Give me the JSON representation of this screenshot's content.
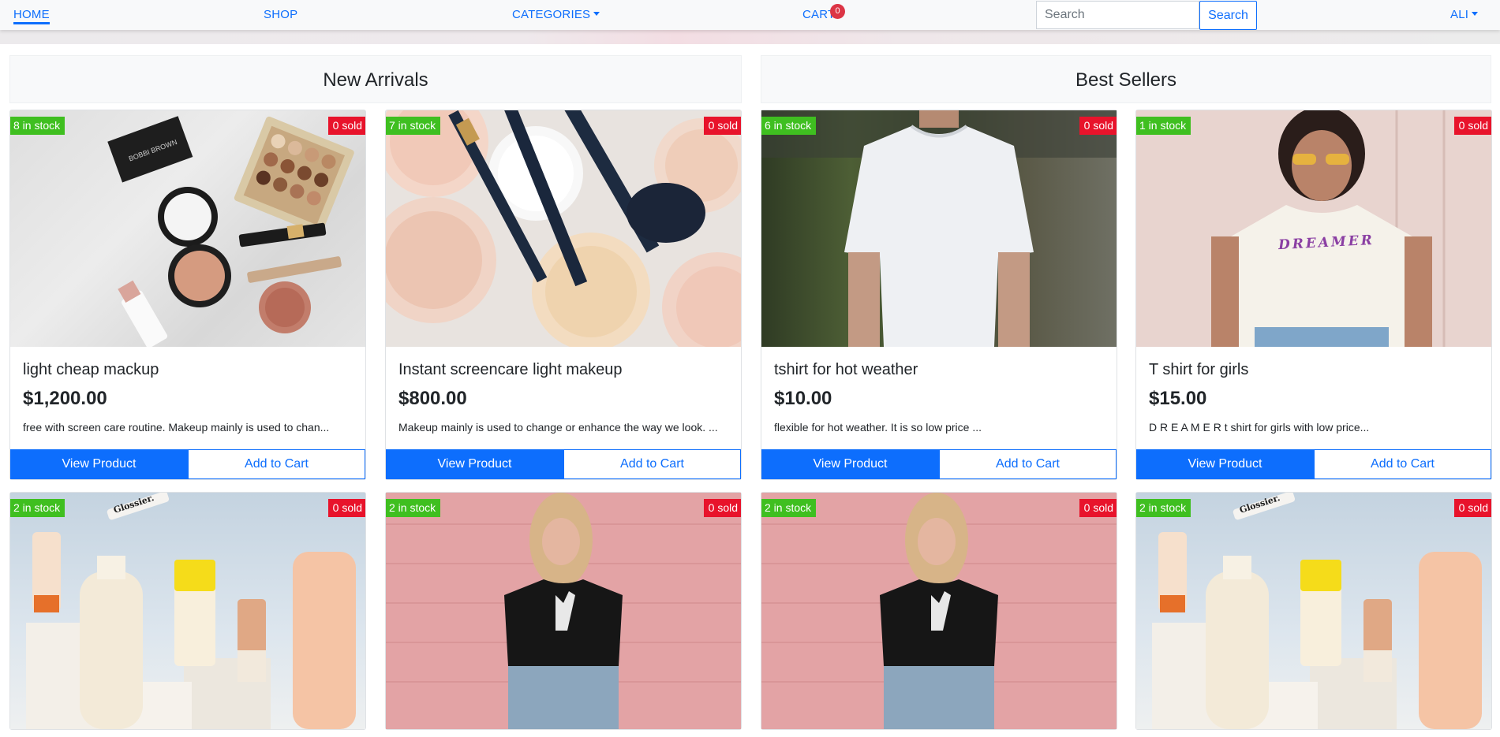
{
  "nav": {
    "home": "HOME",
    "shop": "SHOP",
    "categories": "CATEGORIES",
    "cart": "CART",
    "cart_count": "0",
    "search_placeholder": "Search",
    "search_button": "Search",
    "user": "ALI"
  },
  "sections": {
    "new_arrivals": "New Arrivals",
    "best_sellers": "Best Sellers"
  },
  "products": [
    {
      "stock": "8 in stock",
      "sold": "0 sold",
      "title": "light cheap mackup",
      "price": "$1,200.00",
      "desc": "free with screen care routine. Makeup mainly is used to chan...",
      "view": "View Product",
      "add": "Add to Cart",
      "image_icon": "makeup-palette-image"
    },
    {
      "stock": "7 in stock",
      "sold": "0 sold",
      "title": "Instant screencare light makeup",
      "price": "$800.00",
      "desc": "Makeup mainly is used to change or enhance the way we look. ...",
      "view": "View Product",
      "add": "Add to Cart",
      "image_icon": "powder-brushes-image"
    },
    {
      "stock": "6 in stock",
      "sold": "0 sold",
      "title": "tshirt for hot weather",
      "price": "$10.00",
      "desc": "flexible for hot weather. It is so low price ...",
      "view": "View Product",
      "add": "Add to Cart",
      "image_icon": "white-tshirt-image"
    },
    {
      "stock": "1 in stock",
      "sold": "0 sold",
      "title": "T shirt for girls",
      "price": "$15.00",
      "desc": "D R E A M E R t shirt for girls with low price...",
      "view": "View Product",
      "add": "Add to Cart",
      "image_icon": "dreamer-tshirt-image",
      "shirt_text": "DREAMER"
    },
    {
      "stock": "2 in stock",
      "sold": "0 sold",
      "image_icon": "skincare-bottles-image",
      "brand_text": "Glossier."
    },
    {
      "stock": "2 in stock",
      "sold": "0 sold",
      "image_icon": "black-tshirt-pink-wall-image"
    },
    {
      "stock": "2 in stock",
      "sold": "0 sold",
      "image_icon": "black-tshirt-pink-wall-image"
    },
    {
      "stock": "2 in stock",
      "sold": "0 sold",
      "image_icon": "skincare-bottles-image",
      "brand_text": "Glossier."
    }
  ],
  "colors": {
    "primary": "#0d6efd",
    "stock_ribbon": "#3fbf20",
    "sold_ribbon": "#e8132b"
  }
}
